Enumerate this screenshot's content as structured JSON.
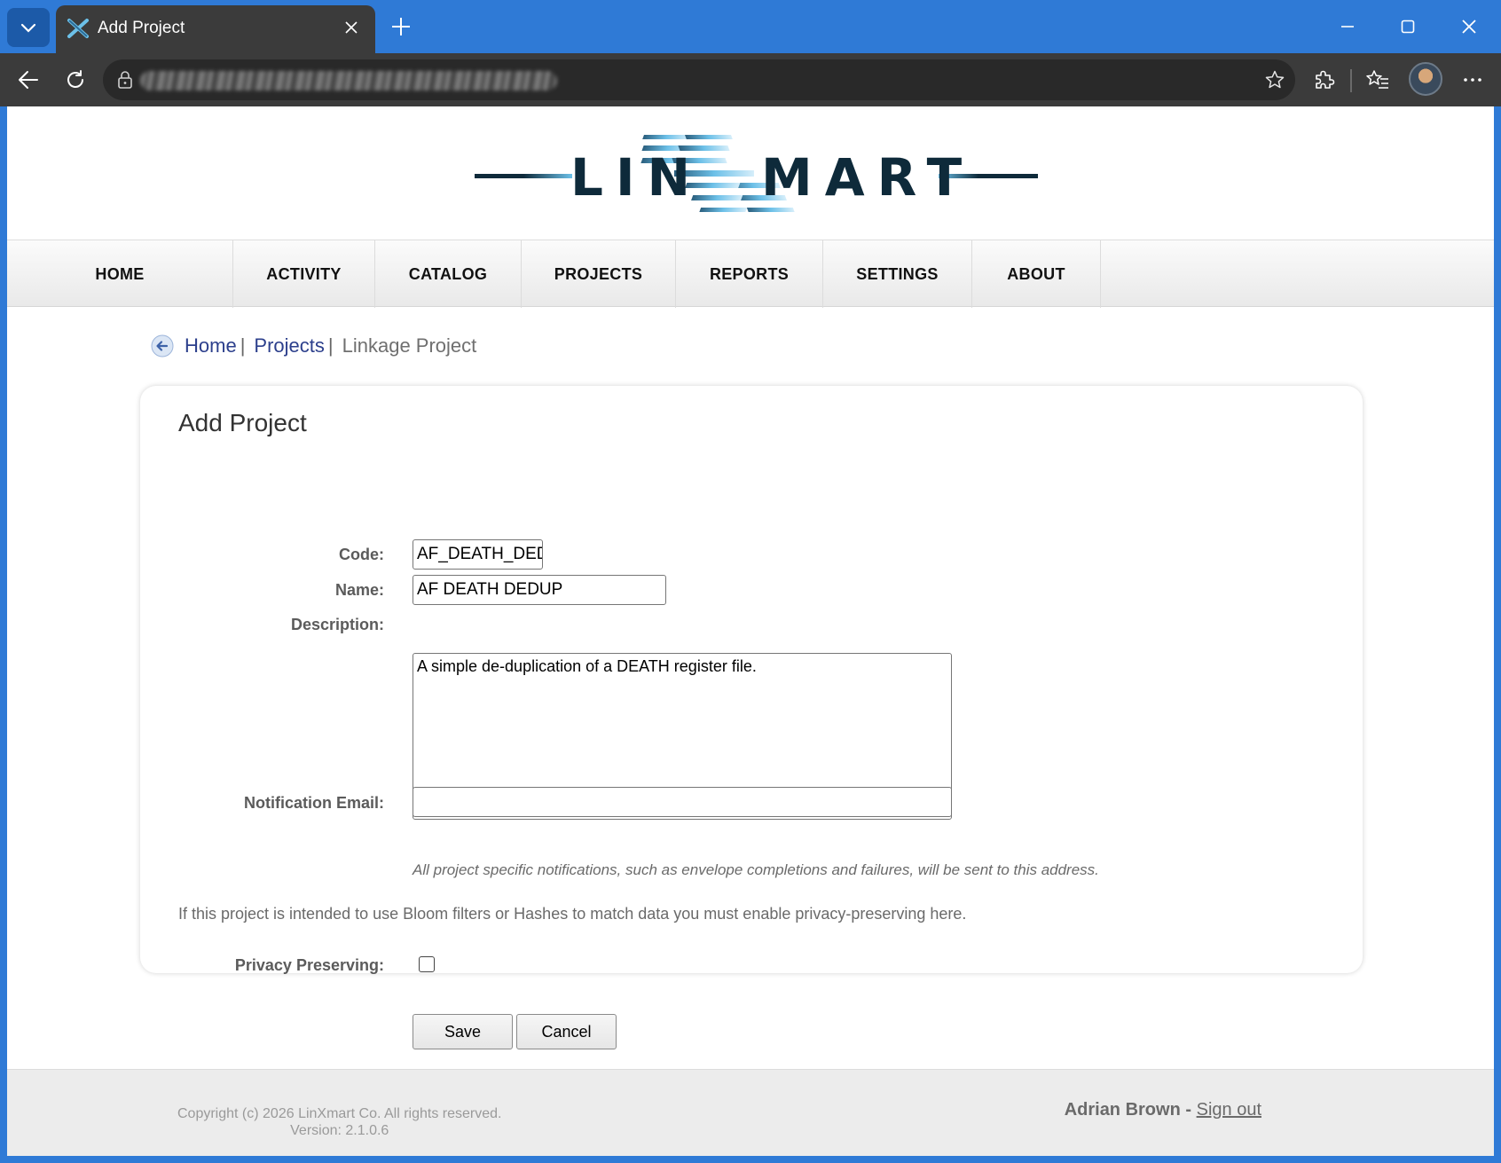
{
  "browser": {
    "tab_title": "Add Project",
    "icons": {
      "tab_menu": "chevron-down-icon",
      "tab_favicon": "linxmart-favicon-icon",
      "tab_close": "close-icon",
      "new_tab": "plus-icon",
      "minimize": "minimize-icon",
      "maximize": "maximize-icon",
      "close_window": "close-icon",
      "back": "back-arrow-icon",
      "refresh": "refresh-icon",
      "lock": "lock-icon",
      "favorite": "star-icon",
      "extensions": "puzzle-icon",
      "favorites": "favorites-icon",
      "more": "more-icon"
    }
  },
  "header": {
    "logo_text": "LINXMART"
  },
  "nav": {
    "items": [
      "HOME",
      "ACTIVITY",
      "CATALOG",
      "PROJECTS",
      "REPORTS",
      "SETTINGS",
      "ABOUT"
    ]
  },
  "breadcrumb": {
    "home": "Home",
    "projects": "Projects",
    "current": "Linkage Project",
    "sep": "|"
  },
  "form": {
    "title": "Add Project",
    "code_label": "Code:",
    "code_value": "AF_DEATH_DEDUP",
    "name_label": "Name:",
    "name_value": "AF DEATH DEDUP",
    "description_label": "Description:",
    "description_value": "A simple de-duplication of a DEATH register file.",
    "email_label": "Notification Email:",
    "email_value": "",
    "email_hint": "All project specific notifications, such as envelope completions and failures, will be sent to this address.",
    "privacy_info": "If this project is intended to use Bloom filters or Hashes to match data you must enable privacy-preserving here.",
    "privacy_label": "Privacy Preserving:",
    "privacy_checked": false,
    "save_label": "Save",
    "cancel_label": "Cancel"
  },
  "footer": {
    "copyright": "Copyright (c) 2026 LinXmart Co. All rights reserved.",
    "version": "Version: 2.1.0.6",
    "user_name": "Adrian Brown",
    "dash": "-",
    "signout": "Sign out"
  },
  "colors": {
    "browser_frame": "#2f7ad6",
    "toolbar": "#3b3b3b",
    "link": "#2c3f8c",
    "logo_dark": "#0e2a3a",
    "logo_accent": "#6cc0e8"
  }
}
